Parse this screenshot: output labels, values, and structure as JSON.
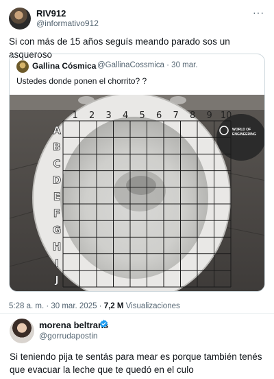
{
  "tweet": {
    "author_name": "RIV912",
    "author_handle": "@informativo912",
    "more_label": "···",
    "text": "Si con más de 15 años seguís meando parado sos un asqueroso"
  },
  "quote": {
    "author_name": "Gallina Cósmica",
    "author_handle": "@GallinaCossmica · 30 mar.",
    "text": "Ustedes donde ponen el chorrito? ?",
    "image": {
      "columns": [
        "1",
        "2",
        "3",
        "4",
        "5",
        "6",
        "7",
        "8",
        "9",
        "10"
      ],
      "rows": [
        "A",
        "B",
        "C",
        "D",
        "E",
        "F",
        "G",
        "H",
        "I",
        "J"
      ],
      "sticker_text": "WORLD OF ENGINEERING"
    }
  },
  "meta": {
    "time": "5:28 a. m. · 30 mar. 2025 · ",
    "views_count": "7,2 M",
    "views_label": " Visualizaciones"
  },
  "reply": {
    "author_name": "morena beltrans",
    "author_handle": "@gorrudapostin",
    "text": "Si teniendo pija te sentás para mear es porque también tenés que evacuar la leche que te quedó en el culo"
  },
  "colors": {
    "accent": "#1d9bf0",
    "text_secondary": "#536471",
    "border": "#cfd9de"
  }
}
